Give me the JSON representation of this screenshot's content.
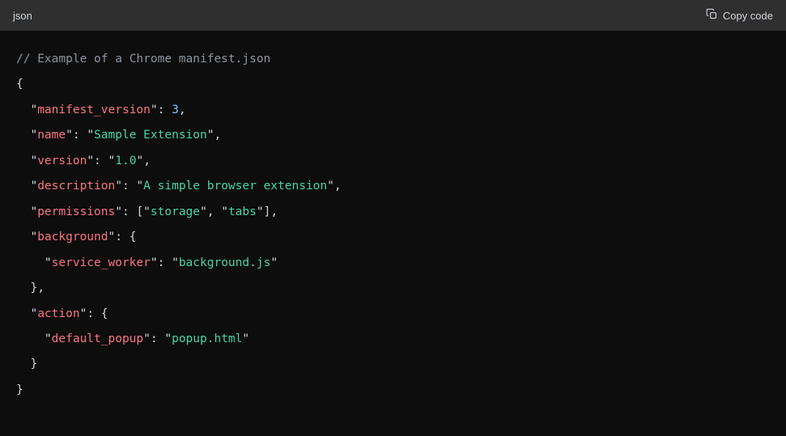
{
  "header": {
    "language": "json",
    "copy_label": "Copy code"
  },
  "code": {
    "comment_prefix": "// ",
    "comment_text": "Example of a Chrome manifest.json",
    "brace_open": "{",
    "brace_close": "}",
    "bracket_open": "[",
    "bracket_close": "]",
    "colon": ": ",
    "comma": ",",
    "quote": "\"",
    "indent1": "  ",
    "indent2": "    ",
    "keys": {
      "manifest_version": "manifest_version",
      "name": "name",
      "version": "version",
      "description": "description",
      "permissions": "permissions",
      "background": "background",
      "service_worker": "service_worker",
      "action": "action",
      "default_popup": "default_popup"
    },
    "vals": {
      "manifest_version": "3",
      "name": "Sample Extension",
      "version": "1.0",
      "description": "A simple browser extension",
      "perm0": "storage",
      "perm1": "tabs",
      "service_worker": "background.js",
      "default_popup": "popup.html"
    }
  }
}
